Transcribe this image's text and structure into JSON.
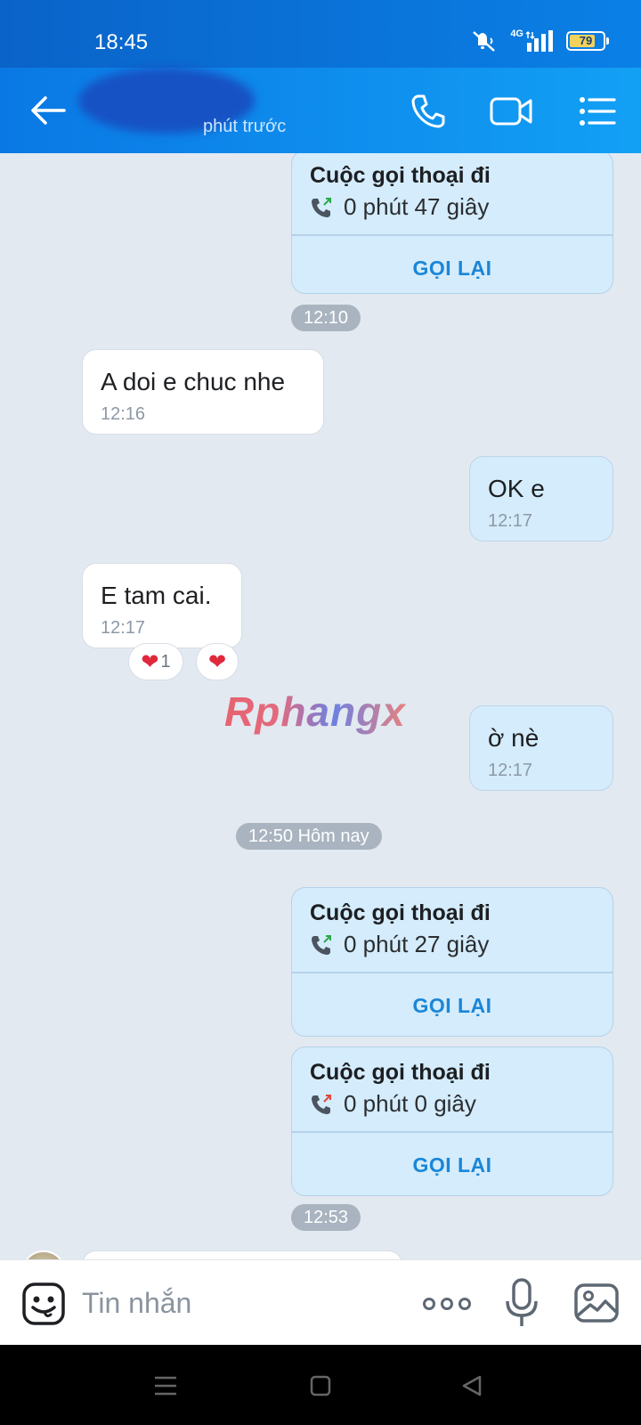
{
  "status_bar": {
    "time": "18:45",
    "network": "4G",
    "battery": "79",
    "battery_level_percent": 79,
    "icons": [
      "mute-icon",
      "signal-icon",
      "battery-icon"
    ]
  },
  "header": {
    "last_seen": "phút trước",
    "icons": [
      "back-arrow-icon",
      "phone-icon",
      "video-camera-icon",
      "list-menu-icon"
    ]
  },
  "colors": {
    "header_blue": "#0a78e4",
    "outgoing_bubble": "#d4ecfb",
    "incoming_bubble": "#ffffff",
    "chat_background": "#e2e9f1",
    "call_back_text": "#1a86d8",
    "call_arrow_green": "#2aa84a",
    "call_arrow_red": "#e0473d"
  },
  "messages": [
    {
      "kind": "call",
      "direction": "out",
      "title": "Cuộc gọi thoại đi",
      "duration": "0 phút 47 giây",
      "action": "GỌI LẠI",
      "arrow": "green"
    },
    {
      "kind": "time_chip",
      "text": "12:10"
    },
    {
      "kind": "text",
      "direction": "in",
      "text": "A doi e chuc nhe",
      "time": "12:16"
    },
    {
      "kind": "text",
      "direction": "out",
      "text": "OK e",
      "time": "12:17"
    },
    {
      "kind": "text",
      "direction": "in",
      "text": "E tam cai.",
      "time": "12:17",
      "reactions": {
        "count": "1",
        "emoji": "❤",
        "add_emoji": "❤"
      }
    },
    {
      "kind": "text",
      "direction": "out",
      "text": "ờ nè",
      "time": "12:17"
    },
    {
      "kind": "time_chip",
      "text": "12:50 Hôm nay"
    },
    {
      "kind": "call",
      "direction": "out",
      "title": "Cuộc gọi thoại đi",
      "duration": "0 phút 27 giây",
      "action": "GỌI LẠI",
      "arrow": "green"
    },
    {
      "kind": "call",
      "direction": "out",
      "title": "Cuộc gọi thoại đi",
      "duration": "0 phút 0 giây",
      "action": "GỌI LẠI",
      "arrow": "red"
    },
    {
      "kind": "time_chip",
      "text": "12:53"
    }
  ],
  "watermark": "Rphangx",
  "composer": {
    "placeholder": "Tin nhắn",
    "icons": [
      "emoji-icon",
      "more-icon",
      "microphone-icon",
      "image-icon"
    ]
  },
  "navbar": {
    "icons": [
      "recents-icon",
      "home-icon",
      "back-icon"
    ]
  }
}
